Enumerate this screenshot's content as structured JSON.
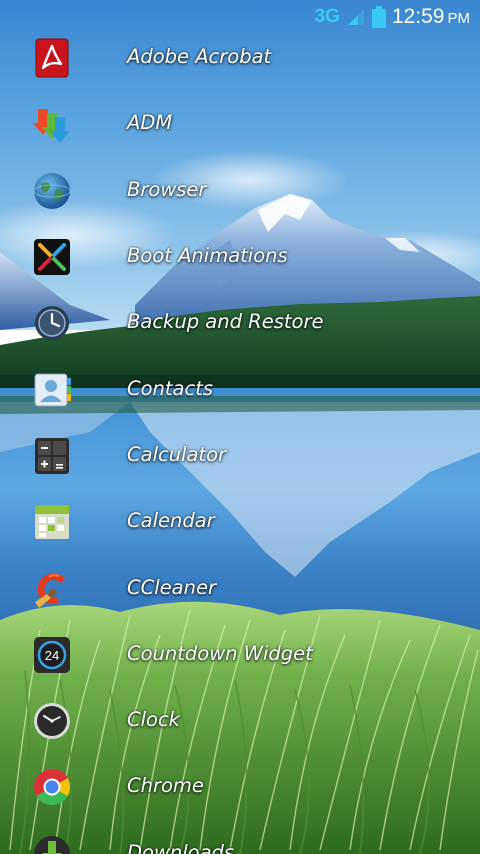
{
  "status_bar": {
    "network": "3G",
    "time": "12:59",
    "ampm": "PM",
    "accent_color": "#38c9f2"
  },
  "apps": [
    {
      "label": "Adobe Acrobat",
      "icon": "adobe-acrobat-icon"
    },
    {
      "label": "ADM",
      "icon": "adm-icon"
    },
    {
      "label": "Browser",
      "icon": "globe-icon"
    },
    {
      "label": "Boot Animations",
      "icon": "boot-animations-icon"
    },
    {
      "label": "Backup and Restore",
      "icon": "backup-clock-icon"
    },
    {
      "label": "Contacts",
      "icon": "contacts-icon"
    },
    {
      "label": "Calculator",
      "icon": "calculator-icon"
    },
    {
      "label": "Calendar",
      "icon": "calendar-icon"
    },
    {
      "label": "CCleaner",
      "icon": "ccleaner-icon"
    },
    {
      "label": "Countdown Widget",
      "icon": "countdown-icon",
      "badge": "24"
    },
    {
      "label": "Clock",
      "icon": "clock-icon"
    },
    {
      "label": "Chrome",
      "icon": "chrome-icon"
    },
    {
      "label": "Downloads",
      "icon": "download-icon"
    }
  ]
}
